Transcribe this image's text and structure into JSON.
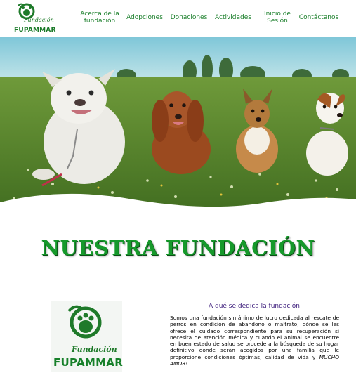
{
  "brand": {
    "logo_top": "Fundación",
    "logo_name": "FUPAMMAR"
  },
  "nav": {
    "items": [
      {
        "line1": "Acerca de la",
        "line2": "fundación"
      },
      {
        "line1": "Adopciones"
      },
      {
        "line1": "Donaciones"
      },
      {
        "line1": "Actividades"
      },
      {
        "line1": "Inicio de",
        "line2": "Sesión"
      },
      {
        "line1": "Contáctanos"
      }
    ]
  },
  "main": {
    "title": "NUESTRA FUNDACIÓN"
  },
  "about": {
    "heading": "A qué se dedica la fundación",
    "body": "Somos una fundación sin ánimo de lucro dedicada al rescate de perros en condición de abandono o maltrato, dónde se les ofrece el cuidado correspondiente para su recuperación si necesita de atención médica y cuando el animal se encuentre en buen estado de salud se procede a la búsqueda de su hogar definitivo donde serán acogidos por una familia que le proporcione condiciones óptimas, calidad de vida y ",
    "emphasis": "MUCHO AMOR!",
    "logo_top": "Fundación",
    "logo_name": "FUPAMMAR"
  },
  "colors": {
    "brand_green": "#1b7f2b",
    "title_green": "#16992b",
    "heading_purple": "#3a1a7a"
  }
}
